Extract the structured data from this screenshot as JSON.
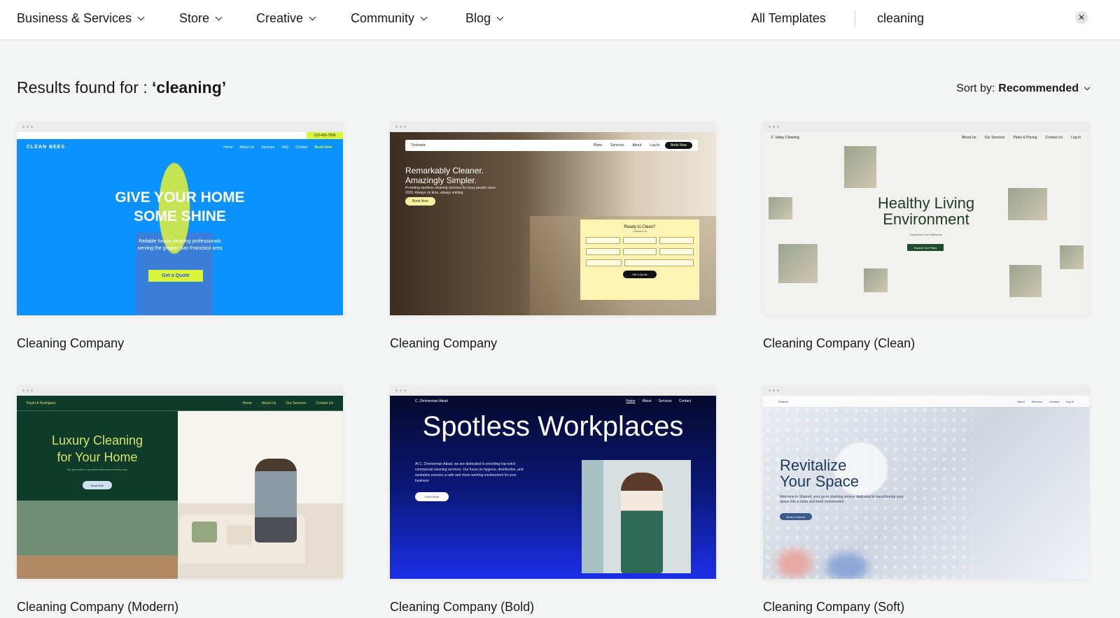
{
  "nav": {
    "items": [
      {
        "label": "Business & Services"
      },
      {
        "label": "Store"
      },
      {
        "label": "Creative"
      },
      {
        "label": "Community"
      },
      {
        "label": "Blog"
      }
    ],
    "all_templates": "All Templates",
    "search_value": "cleaning",
    "clear_glyph": "✕"
  },
  "results": {
    "prefix": "Results found for : ",
    "query": "‘cleaning’"
  },
  "sort": {
    "label": "Sort by:",
    "value": "Recommended"
  },
  "cards": [
    {
      "title": "Cleaning Company",
      "preview": {
        "logo": "CLEAN BEES",
        "links": [
          "Home",
          "About Us",
          "Services",
          "FAQ",
          "Contact",
          "Book Now"
        ],
        "phone": "123-456-7890",
        "headline_1": "GIVE YOUR HOME",
        "headline_2": "SOME SHINE",
        "sub_1": "Reliable house cleaning professionals",
        "sub_2": "serving the greater San Francisco area",
        "cta": "Get a Quote"
      }
    },
    {
      "title": "Cleaning Company",
      "preview": {
        "logo": "Tinclearic",
        "links": [
          "Plans",
          "Services",
          "About",
          "Log In"
        ],
        "book": "Book Now",
        "headline_1": "Remarkably Cleaner.",
        "headline_2": "Amazingly Simpler.",
        "paragraph": "Providing spotless cleaning services for busy people since 2026. Always on time, always smiling.",
        "button": "Book Now",
        "form_title": "Ready to Clean?",
        "form_sub": "Contact Us",
        "form_button": "Get a Quote"
      }
    },
    {
      "title": "Cleaning Company (Clean)",
      "preview": {
        "logo": "F. Valley Cleaning",
        "links": [
          "About Us",
          "Our Services",
          "Plans & Pricing",
          "Contact Us",
          "Log In"
        ],
        "headline_1": "Healthy Living",
        "headline_2": "Environment",
        "sub": "Experience the Difference",
        "button": "Explore Our Plans"
      }
    },
    {
      "title": "Cleaning Company (Modern)",
      "preview": {
        "logo": "Rushi & Rodriguez",
        "links": [
          "Home",
          "About Us",
          "Our Services",
          "Contact Us"
        ],
        "headline_1": "Luxury Cleaning",
        "headline_2": "for Your Home",
        "sub": "We guarantee a spotless environment every time",
        "button": "Book Now"
      }
    },
    {
      "title": "Cleaning Company (Bold)",
      "preview": {
        "logo": "C. Zimmerman Abiad",
        "links": [
          "Home",
          "About",
          "Services",
          "Contact"
        ],
        "headline": "Spotless Workplaces",
        "paragraph": "At C. Zimmerman Abiad, we are dedicated to providing top-notch commercial cleaning services. Our focus on hygiene, disinfection, and sanitation ensures a safe and clean working environment for your business",
        "button": "Learn More"
      }
    },
    {
      "title": "Cleaning Company (Soft)",
      "preview": {
        "logo": "Shatoof",
        "links": [
          "About",
          "Services",
          "Contact",
          "Log In"
        ],
        "headline_1": "Revitalize",
        "headline_2": "Your Space",
        "paragraph": "Welcome to Shatoof, your go-to cleaning service dedicated to transforming your space into a clean and fresh environment",
        "button": "Book a Service"
      }
    }
  ]
}
